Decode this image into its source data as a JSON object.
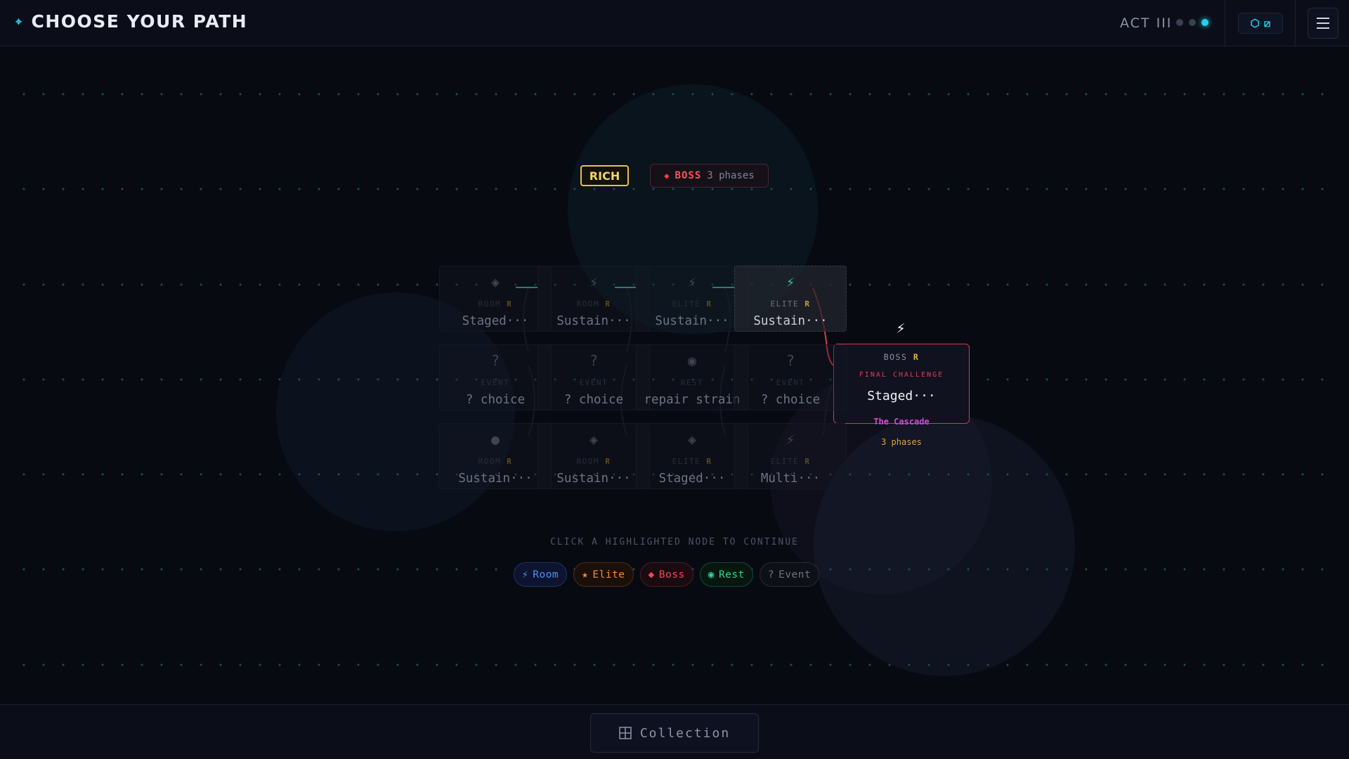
{
  "header": {
    "title": "CHOOSE YOUR PATH",
    "title_icon": "diamond-icon",
    "act_label": "ACT III",
    "act_progress": {
      "current": 3,
      "total": 3
    },
    "currency_icons": [
      "hexagon-icon",
      "slashed-square-icon"
    ],
    "menu_icon": "hamburger-menu-icon"
  },
  "badges": {
    "rich": "RICH",
    "boss_label": "BOSS",
    "boss_phases": "3 phases"
  },
  "map": {
    "rows": [
      [
        {
          "icon": "◈",
          "icon_name": "diamond-icon",
          "type": "ROOM",
          "rarity": "R",
          "name": "Staged···",
          "state": "locked"
        },
        {
          "icon": "⚡",
          "icon_name": "bolt-icon",
          "type": "ROOM",
          "rarity": "R",
          "name": "Sustain···",
          "state": "locked"
        },
        {
          "icon": "⚡",
          "icon_name": "bolt-icon",
          "type": "ELITE",
          "rarity": "R",
          "name": "Sustain···",
          "state": "locked"
        },
        {
          "icon": "⚡",
          "icon_name": "bolt-icon",
          "type": "ELITE",
          "rarity": "R",
          "name": "Sustain···",
          "state": "current"
        }
      ],
      [
        {
          "icon": "?",
          "icon_name": "question-icon",
          "type": "EVENT",
          "rarity": "",
          "name": "? choice",
          "state": "locked"
        },
        {
          "icon": "?",
          "icon_name": "question-icon",
          "type": "EVENT",
          "rarity": "",
          "name": "? choice",
          "state": "locked"
        },
        {
          "icon": "◉",
          "icon_name": "target-icon",
          "type": "REST",
          "rarity": "",
          "name": "repair strain",
          "state": "locked"
        },
        {
          "icon": "?",
          "icon_name": "question-icon",
          "type": "EVENT",
          "rarity": "",
          "name": "? choice",
          "state": "locked"
        }
      ],
      [
        {
          "icon": "●",
          "icon_name": "dot-icon",
          "type": "ROOM",
          "rarity": "R",
          "name": "Sustain···",
          "state": "locked"
        },
        {
          "icon": "◈",
          "icon_name": "diamond-icon",
          "type": "ROOM",
          "rarity": "R",
          "name": "Sustain···",
          "state": "locked"
        },
        {
          "icon": "◈",
          "icon_name": "diamond-icon",
          "type": "ELITE",
          "rarity": "R",
          "name": "Staged···",
          "state": "locked"
        },
        {
          "icon": "⚡",
          "icon_name": "bolt-icon",
          "type": "ELITE",
          "rarity": "R",
          "name": "Multi···",
          "state": "locked"
        }
      ]
    ],
    "boss": {
      "icon": "⚡",
      "icon_name": "bolt-icon",
      "type": "BOSS",
      "rarity": "R",
      "tag": "FINAL CHALLENGE",
      "name": "Staged···",
      "subtitle": "The Cascade",
      "phases": "3 phases"
    }
  },
  "instruction": "CLICK A HIGHLIGHTED NODE TO CONTINUE",
  "legend": [
    {
      "icon": "⚡",
      "icon_name": "bolt-icon",
      "label": "Room",
      "kind": "room",
      "color": "#4f8ff5"
    },
    {
      "icon": "★",
      "icon_name": "star-icon",
      "label": "Elite",
      "kind": "elite",
      "color": "#f08f3a"
    },
    {
      "icon": "◆",
      "icon_name": "gem-icon",
      "label": "Boss",
      "kind": "boss",
      "color": "#f0465a"
    },
    {
      "icon": "◉",
      "icon_name": "target-icon",
      "label": "Rest",
      "kind": "rest",
      "color": "#2fd494"
    },
    {
      "icon": "?",
      "icon_name": "question-icon",
      "label": "Event",
      "kind": "event",
      "color": "#6c7385"
    }
  ],
  "footer": {
    "collection_label": "Collection",
    "collection_icon": "grid-icon"
  },
  "colors": {
    "accent": "#22d3ee",
    "boss": "#e0344a",
    "path": "#2fc48c",
    "rarity": "#e5b640",
    "rich": "#e5c04a"
  }
}
